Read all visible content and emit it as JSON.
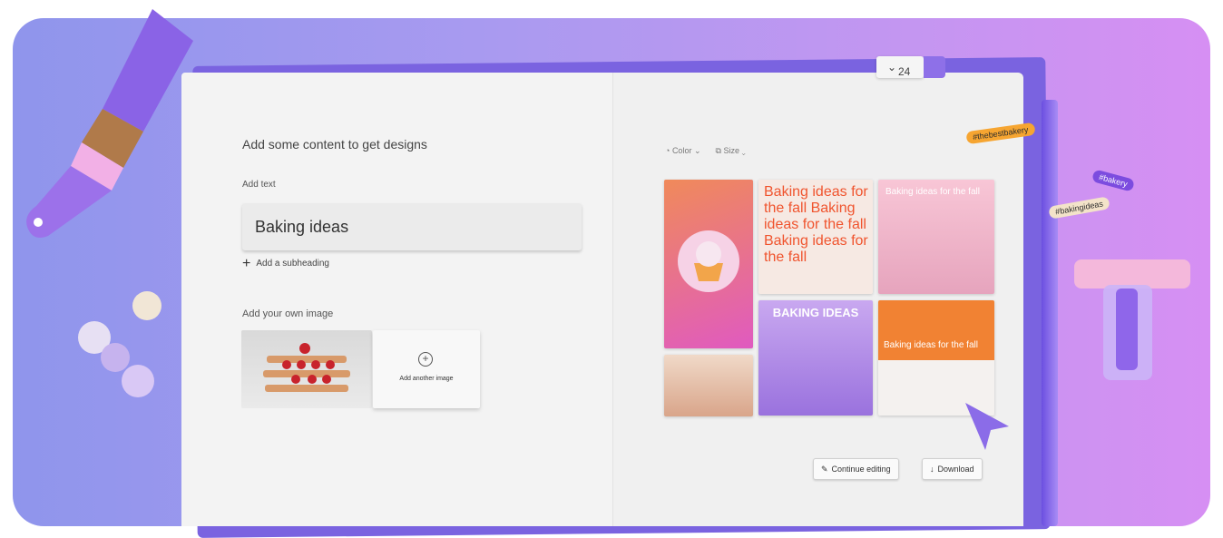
{
  "editor": {
    "heading": "Add some content to get designs",
    "add_text_label": "Add text",
    "text_value": "Baking ideas",
    "add_subheading": "Add a subheading",
    "add_image_label": "Add your own image",
    "add_another_image": "Add another image"
  },
  "preview": {
    "toolbar": {
      "color_label": "Color",
      "size_label": "Size"
    },
    "tiles": {
      "text_tile": "Baking ideas for the fall Baking ideas for the fall Baking ideas for the fall",
      "pink_tile": "Baking ideas for the fall",
      "purple_tile": "BAKING IDEAS",
      "orange_tile": "Baking ideas for the fall"
    },
    "buttons": {
      "continue_editing": "Continue editing",
      "download": "Download"
    }
  },
  "decor": {
    "font_size": "24",
    "tags": [
      "#thebestbakery",
      "#bakery",
      "#bakingideas"
    ]
  },
  "colors": {
    "accent_purple": "#8e70e8",
    "orange": "#f0542e"
  }
}
